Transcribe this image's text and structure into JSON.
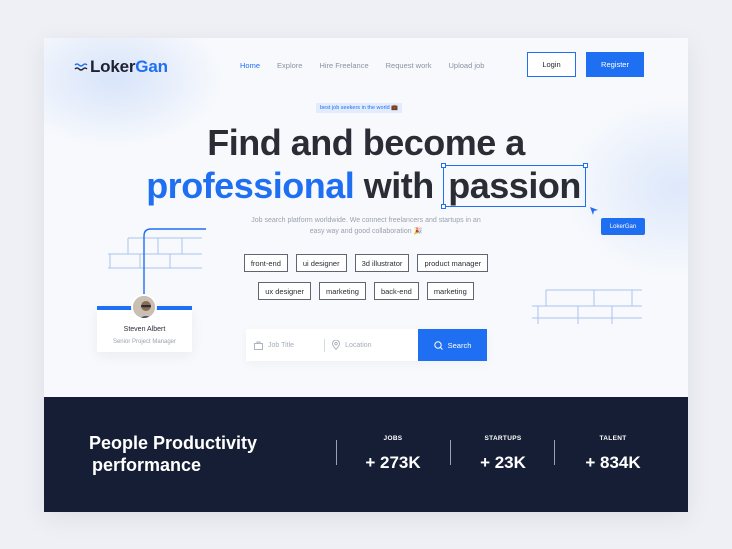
{
  "brand": {
    "logo_icon": "waves-icon",
    "name_part1": "Loker",
    "name_part2": "Gan",
    "accent": "#1f6ff2",
    "dark": "#161e35"
  },
  "nav": {
    "items": [
      {
        "label": "Home",
        "active": true
      },
      {
        "label": "Explore"
      },
      {
        "label": "Hire Freelance"
      },
      {
        "label": "Request work"
      },
      {
        "label": "Upload job"
      }
    ],
    "login_label": "Login",
    "register_label": "Register"
  },
  "hero": {
    "pill": "best job seekers in the world 💼",
    "line1": "Find and become a",
    "line2_accent": "professional",
    "line2_mid": "with",
    "line2_boxed": "passion",
    "cursor_tag": "LokerGan",
    "subtitle": "Job search platform worldwide. We connect freelancers and startups in an easy way and good collaboration 🎉"
  },
  "tags": {
    "row1": [
      "front-end",
      "ui designer",
      "3d illustrator",
      "product manager"
    ],
    "row2": [
      "ux designer",
      "marketing",
      "back-end",
      "marketing"
    ]
  },
  "search": {
    "job_placeholder": "Job Title",
    "location_placeholder": "Location",
    "button_label": "Search"
  },
  "profile": {
    "name": "Steven Albert",
    "role": "Senior Project Manager"
  },
  "stats": {
    "title_line1": "People Productivity",
    "title_line2": "performance",
    "items": [
      {
        "label": "JOBS",
        "value": "+ 273K"
      },
      {
        "label": "STARTUPS",
        "value": "+ 23K"
      },
      {
        "label": "TALENT",
        "value": "+ 834K"
      }
    ]
  }
}
